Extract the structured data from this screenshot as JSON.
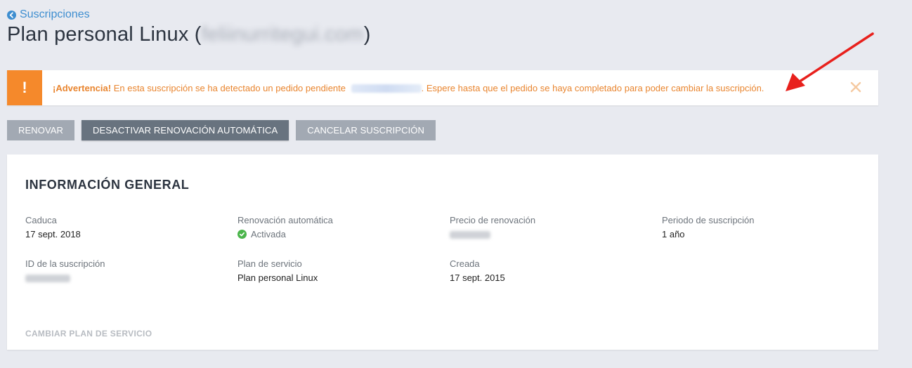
{
  "nav": {
    "back_label": "Suscripciones"
  },
  "header": {
    "title_prefix": "Plan personal Linux (",
    "title_domain": "feliinurritegui.com",
    "title_suffix": ")"
  },
  "alert": {
    "icon": "!",
    "strong": "¡Advertencia!",
    "text_before": "En esta suscripción se ha detectado un pedido pendiente",
    "text_after": ". Espere hasta que el pedido se haya completado para poder cambiar la suscripción.",
    "close_icon": "close-icon",
    "color": "#f5892b"
  },
  "actions": {
    "renew": "Renovar",
    "disable_autorenew": "Desactivar renovación automática",
    "cancel": "Cancelar suscripción"
  },
  "general": {
    "title": "Información general",
    "fields": [
      {
        "label": "Caduca",
        "value": "17 sept. 2018"
      },
      {
        "label": "Renovación automática",
        "value": "Activada"
      },
      {
        "label": "Precio de renovación",
        "value": ""
      },
      {
        "label": "Periodo de suscripción",
        "value": "1 año"
      },
      {
        "label": "ID de la suscripción",
        "value": ""
      },
      {
        "label": "Plan de servicio",
        "value": "Plan personal Linux"
      },
      {
        "label": "Creada",
        "value": "17 sept. 2015"
      }
    ],
    "change_plan": "Cambiar plan de servicio"
  },
  "colors": {
    "accent": "#3e8ed0",
    "warning": "#f5892b",
    "success": "#4bb54b",
    "annotation_arrow": "#e8201c"
  }
}
